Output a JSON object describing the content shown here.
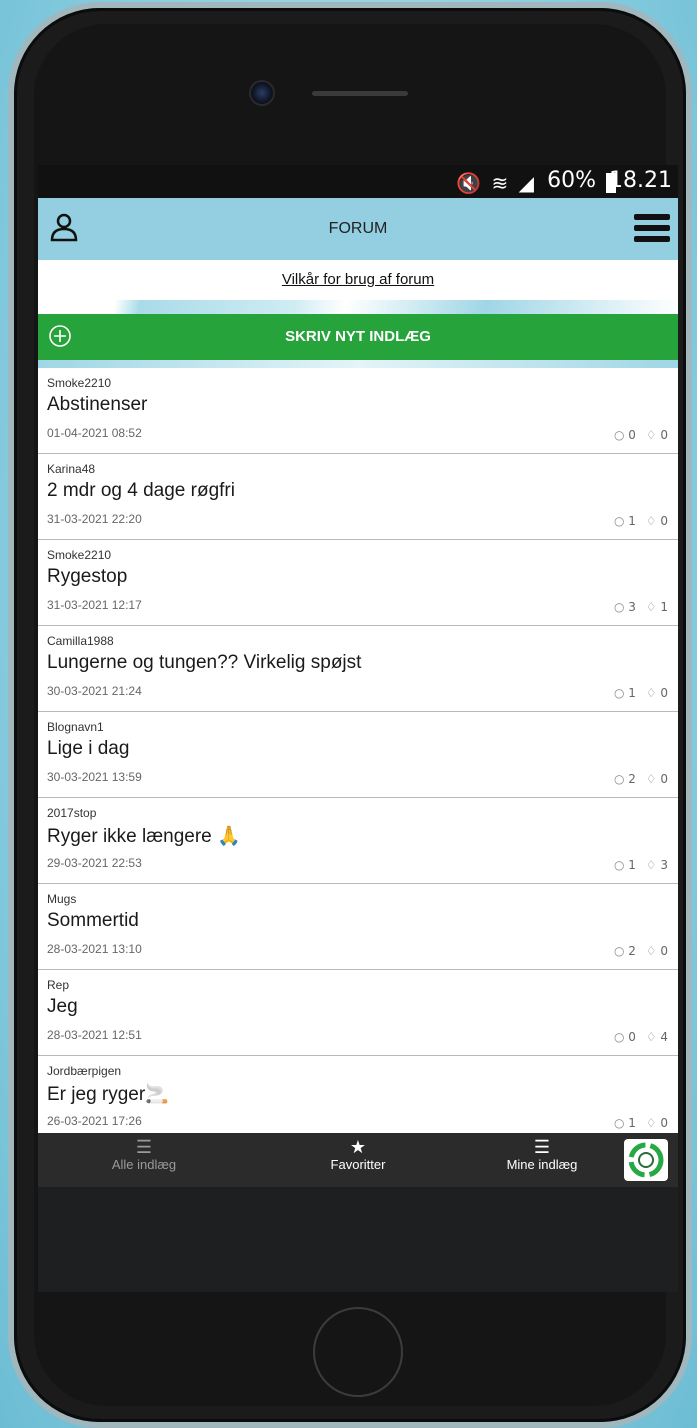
{
  "statusbar": {
    "icons": "🔇 ≋ ◢",
    "battery": "60%",
    "time": "18.21"
  },
  "header": {
    "title": "FORUM",
    "user_icon": "user-icon",
    "menu_icon": "hamburger-menu-icon"
  },
  "terms_link": "Vilkår for brug af forum",
  "new_post_label": "SKRIV NYT INDLÆG",
  "posts": [
    {
      "author": "Smoke2210",
      "title": "Abstinenser",
      "date": "01-04-2021 08:52",
      "comments": "0",
      "likes": "0"
    },
    {
      "author": "Karina48",
      "title": "2 mdr og 4 dage røgfri",
      "date": "31-03-2021 22:20",
      "comments": "1",
      "likes": "0"
    },
    {
      "author": "Smoke2210",
      "title": "Rygestop",
      "date": "31-03-2021 12:17",
      "comments": "3",
      "likes": "1"
    },
    {
      "author": "Camilla1988",
      "title": "Lungerne og tungen?? Virkelig spøjst",
      "date": "30-03-2021 21:24",
      "comments": "1",
      "likes": "0"
    },
    {
      "author": "Blognavn1",
      "title": "Lige i dag",
      "date": "30-03-2021 13:59",
      "comments": "2",
      "likes": "0"
    },
    {
      "author": "2017stop",
      "title": "Ryger ikke længere 🙏",
      "date": "29-03-2021 22:53",
      "comments": "1",
      "likes": "3"
    },
    {
      "author": "Mugs",
      "title": "Sommertid",
      "date": "28-03-2021 13:10",
      "comments": "2",
      "likes": "0"
    },
    {
      "author": "Rep",
      "title": "Jeg",
      "date": "28-03-2021 12:51",
      "comments": "0",
      "likes": "4"
    },
    {
      "author": "Jordbærpigen",
      "title": "Er jeg ryger🚬",
      "date": "26-03-2021 17:26",
      "comments": "1",
      "likes": "0"
    }
  ],
  "bottom_nav": {
    "all": "Alle indlæg",
    "favorites": "Favoritter",
    "mine": "Mine indlæg"
  },
  "icons": {
    "comment": "💬",
    "like": "👍"
  },
  "colors": {
    "header": "#93cfe0",
    "new_post": "#26a33a",
    "bottom_nav": "#2b2b2b"
  }
}
